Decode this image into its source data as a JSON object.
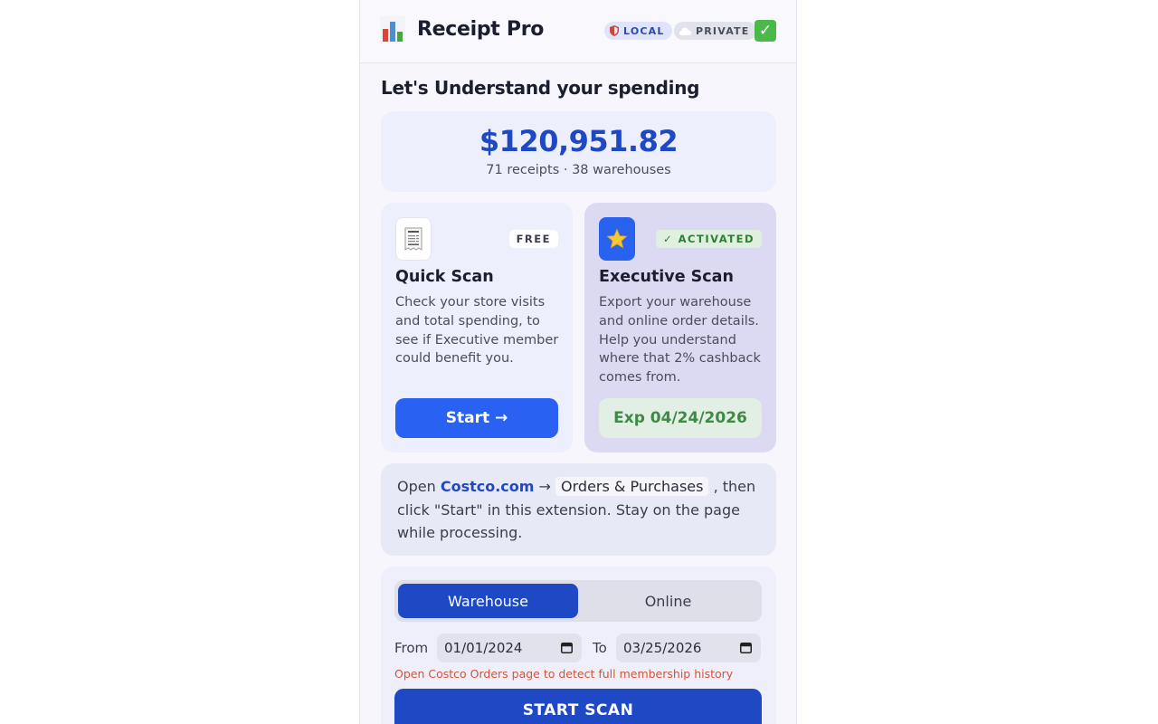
{
  "header": {
    "title": "Receipt Pro",
    "badges": [
      {
        "label": "LOCAL",
        "icon": "shield-icon"
      },
      {
        "label": "PRIVATE",
        "icon": "cloud-icon"
      }
    ],
    "status_icon": "check-mark-icon"
  },
  "headline": "Let's Understand your spending",
  "summary": {
    "total": "$120,951.82",
    "subtitle": "71 receipts · 38 warehouses"
  },
  "cards": {
    "free": {
      "icon": "receipt-icon",
      "badge": "FREE",
      "title": "Quick Scan",
      "description": "Check your store visits and total spending, to see if Executive member could benefit you.",
      "button_label": "Start →"
    },
    "executive": {
      "icon": "star-icon",
      "badge": "✓ ACTIVATED",
      "title": "Executive Scan",
      "description": "Export your warehouse and online order details. Help you understand where that 2% cashback comes from.",
      "expiry": "Exp 04/24/2026"
    }
  },
  "instructions": {
    "open": "Open ",
    "link": "Costco.com",
    "arrow": " → ",
    "chip": "Orders & Purchases",
    "rest": ", then click \"Start\" in this extension. Stay on the page while processing."
  },
  "scan": {
    "tabs": [
      "Warehouse",
      "Online"
    ],
    "active_tab": "Warehouse",
    "from_label": "From",
    "from_value": "01/01/2024",
    "to_label": "To",
    "to_value": "03/25/2026",
    "warning": "Open Costco Orders page to detect full membership history",
    "button_label": "START SCAN"
  },
  "colors": {
    "accent": "#1f49c4",
    "button": "#2962f2",
    "success": "#3d8a46",
    "warning": "#d0563a"
  }
}
